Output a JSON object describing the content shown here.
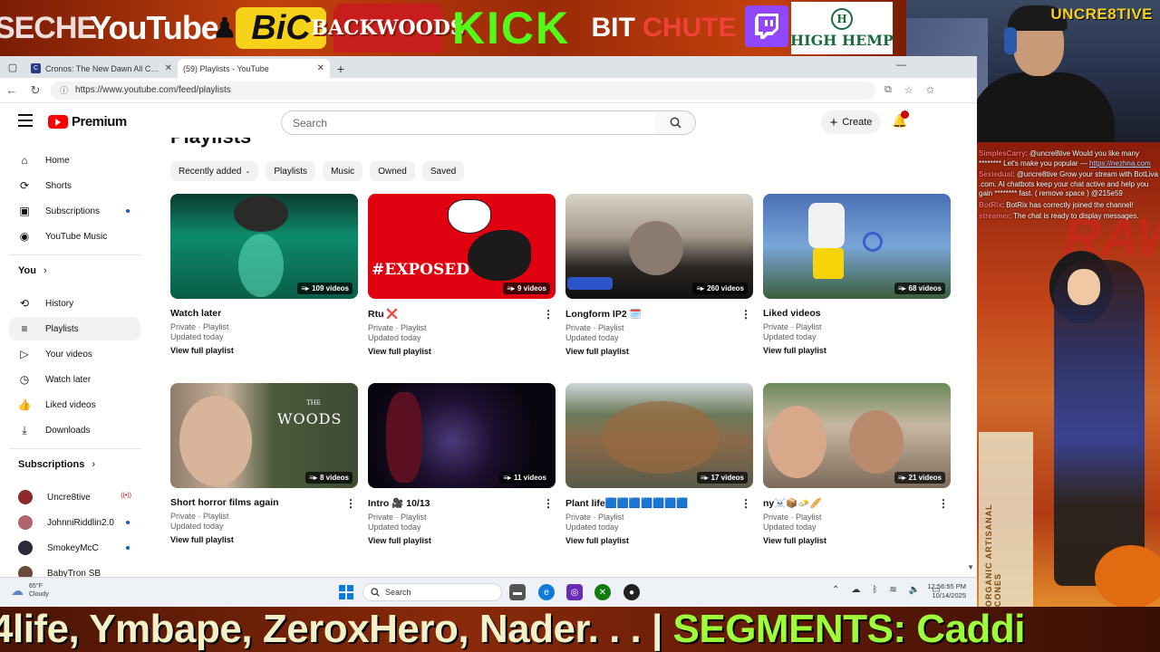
{
  "overlay": {
    "sponsors": {
      "seche": "SECHE",
      "youtube": "YouTube",
      "bic": "BiC",
      "backwoods": "BACKWOODS",
      "kick": "KICK",
      "bitchute_a": "BIT",
      "bitchute_b": "CHUTE",
      "highhemp": "HIGH HEMP"
    },
    "cam_label": "UNCRE8TIVE",
    "chat": [
      {
        "user": "SimplesCarry",
        "text": "@uncre8tive Would you like many ******** Let's make you popular — ",
        "link": "https://nezhna.com"
      },
      {
        "user": "Sexiedual",
        "text": "@uncre8tive Grow your stream with BotLiva .com. AI chatbots keep your chat active and help you gain ******** fast. ( remove space ) @215e59",
        "link": ""
      },
      {
        "user": "BotRix",
        "text": "BotRix has correctly joined the channel!",
        "link": ""
      },
      {
        "user": "streamer",
        "text": "The chat is ready to display messages.",
        "link": ""
      }
    ],
    "art_raw": "RAW",
    "art_box": "ORGANIC ARTISANAL CONES",
    "ticker_main": "4life, Ymbape, ZeroxHero, Nader. . . | ",
    "ticker_seg": "SEGMENTS: Caddi"
  },
  "browser": {
    "tabs": [
      {
        "title": "Cronos: The New Dawn All Collec",
        "icon": "cronos"
      },
      {
        "title": "(59) Playlists - YouTube",
        "icon": "yt"
      }
    ],
    "url": "https://www.youtube.com/feed/playlists"
  },
  "yt": {
    "brand": "Premium",
    "search_placeholder": "Search",
    "create_label": "Create",
    "page_title": "Playlists",
    "guide_top": [
      {
        "label": "Home",
        "icon": "⌂"
      },
      {
        "label": "Shorts",
        "icon": "⟳"
      },
      {
        "label": "Subscriptions",
        "icon": "▣"
      },
      {
        "label": "YouTube Music",
        "icon": "◉"
      }
    ],
    "you_label": "You",
    "guide_you": [
      {
        "label": "History",
        "icon": "⟲"
      },
      {
        "label": "Playlists",
        "icon": "≡"
      },
      {
        "label": "Your videos",
        "icon": "▷"
      },
      {
        "label": "Watch later",
        "icon": "◷"
      },
      {
        "label": "Liked videos",
        "icon": "👍"
      },
      {
        "label": "Downloads",
        "icon": "⤓"
      }
    ],
    "subs_label": "Subscriptions",
    "subs": [
      {
        "name": "Uncre8tive",
        "color": "#8a2a2a"
      },
      {
        "name": "JohnniRiddlin2.0",
        "color": "#b0646b"
      },
      {
        "name": "SmokeyMcC",
        "color": "#2a2a3a"
      },
      {
        "name": "BabyTron SB",
        "color": "#6a4a3a"
      }
    ],
    "chips": [
      "Recently added",
      "Playlists",
      "Music",
      "Owned",
      "Saved"
    ],
    "playlists": [
      {
        "title": "Watch later",
        "meta1": "Private · Playlist",
        "meta2": "Updated today",
        "link": "View full playlist",
        "count": "109 videos"
      },
      {
        "title": "Rtu ❌",
        "meta1": "Private · Playlist",
        "meta2": "Updated today",
        "link": "View full playlist",
        "count": "9 videos"
      },
      {
        "title": "Longform IP2 🗓️",
        "meta1": "Private · Playlist",
        "meta2": "Updated today",
        "link": "View full playlist",
        "count": "260 videos"
      },
      {
        "title": "Liked videos",
        "meta1": "Private · Playlist",
        "meta2": "Updated today",
        "link": "View full playlist",
        "count": "68 videos"
      },
      {
        "title": "Short horror films again",
        "meta1": "Private · Playlist",
        "meta2": "Updated today",
        "link": "View full playlist",
        "count": "8 videos"
      },
      {
        "title": "Intro 🎥 10/13",
        "meta1": "Private · Playlist",
        "meta2": "Updated today",
        "link": "View full playlist",
        "count": "11 videos"
      },
      {
        "title": "Plant life🟦🟦🟦🟦🟦🟦🟦",
        "meta1": "Private · Playlist",
        "meta2": "Updated today",
        "link": "View full playlist",
        "count": "17 videos"
      },
      {
        "title": "ny☠️📦🧈🥖",
        "meta1": "Private · Playlist",
        "meta2": "Updated today",
        "link": "View full playlist",
        "count": "21 videos"
      }
    ],
    "thumb_text": {
      "exposed": "#EXPOSED",
      "woods_the": "THE",
      "woods": "WOODS"
    }
  },
  "taskbar": {
    "temp": "65°F",
    "weather": "Cloudy",
    "search": "Search",
    "time": "12:56:55 PM",
    "date": "10/14/2025"
  }
}
